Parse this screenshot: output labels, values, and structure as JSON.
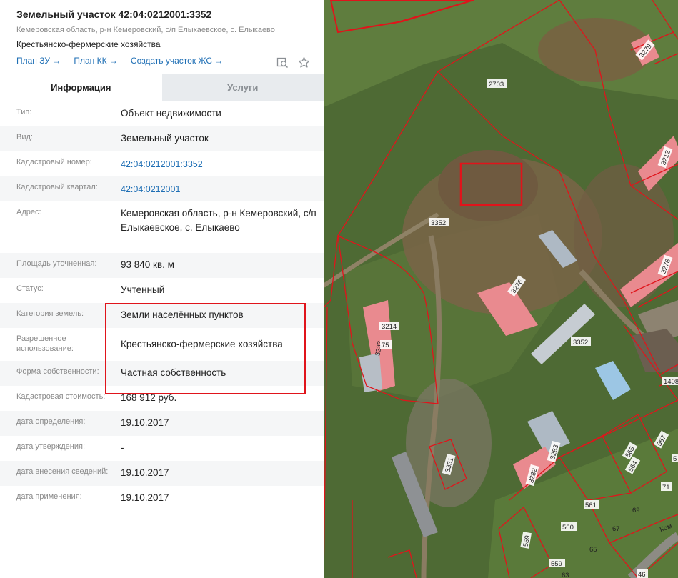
{
  "header": {
    "title": "Земельный участок 42:04:0212001:3352",
    "address": "Кемеровская область, р-н Кемеровский, с/п Елыкаевское, с. Елыкаево",
    "sector": "Крестьянско-фермерские хозяйства",
    "links": [
      "План ЗУ →",
      "План КК →",
      "Создать участок ЖС →"
    ],
    "icons": [
      "map-search-icon",
      "star-icon"
    ]
  },
  "tabs": [
    {
      "label": "Информация",
      "active": true
    },
    {
      "label": "Услуги",
      "active": false
    }
  ],
  "info": [
    {
      "label": "Тип:",
      "value": "Объект недвижимости"
    },
    {
      "label": "Вид:",
      "value": "Земельный участок"
    },
    {
      "label": "Кадастровый номер:",
      "value": "42:04:0212001:3352"
    },
    {
      "label": "Кадастровый квартал:",
      "value": "42:04:0212001"
    },
    {
      "label": "Адрес:",
      "value": "Кемеровская область, р-н Кемеровский, с/п Елыкаевское, с. Елыкаево"
    },
    {
      "label": "Площадь уточненная:",
      "value": "93 840 кв. м"
    },
    {
      "label": "Статус:",
      "value": "Учтенный"
    },
    {
      "label": "Категория земель:",
      "value": "Земли населённых пунктов"
    },
    {
      "label": "Разрешенное использование:",
      "value": "Крестьянско-фермерские хозяйства"
    },
    {
      "label": "Форма собственности:",
      "value": "Частная собственность"
    },
    {
      "label": "Кадастровая стоимость:",
      "value": "168 912 руб."
    },
    {
      "label": "дата определения:",
      "value": "19.10.2017"
    },
    {
      "label": "дата утверждения:",
      "value": "-"
    },
    {
      "label": "дата внесения сведений:",
      "value": "19.10.2017"
    },
    {
      "label": "дата применения:",
      "value": "19.10.2017"
    }
  ],
  "map": {
    "parcel_labels": [
      "2703",
      "3279",
      "3212",
      "3352",
      "3278",
      "3276",
      "3214",
      "3233",
      "75",
      "3352",
      "1408",
      "3351",
      "3283",
      "3282",
      "567",
      "565",
      "564",
      "71",
      "69",
      "561",
      "560",
      "559",
      "67",
      "65",
      "559",
      "63",
      "Ком",
      "46",
      "5"
    ],
    "colors": {
      "boundary": "#e0141b",
      "roof": "#e98a8f",
      "grass": "#5d7a3a",
      "dirt": "#7a6448"
    }
  }
}
